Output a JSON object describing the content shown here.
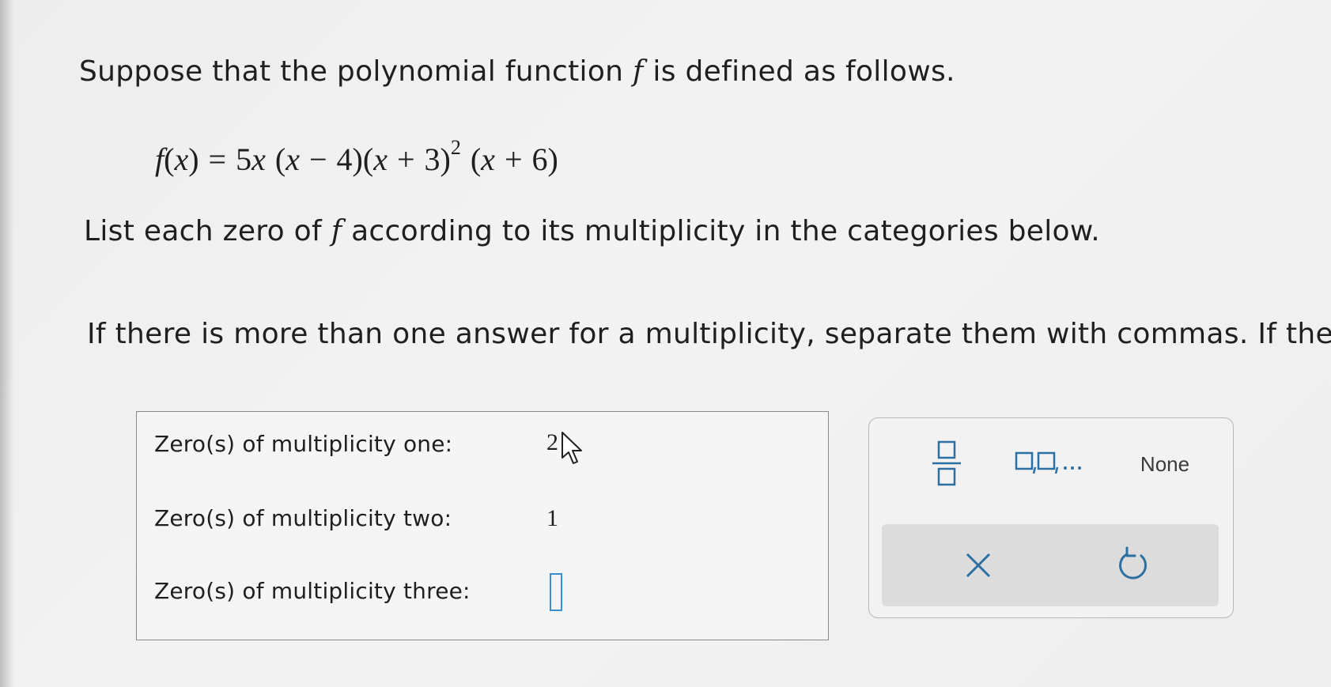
{
  "problem": {
    "intro_before": "Suppose that the polynomial function ",
    "function_name": "f",
    "intro_after": " is defined as follows.",
    "formula": {
      "lhs_fn": "f",
      "lhs_arg": "x",
      "eq": " = 5",
      "t1": "x",
      "p2_open": " (",
      "t2": "x",
      "p2_rest": " − 4)",
      "p3_open": "(",
      "t3": "x",
      "p3_rest": " + 3)",
      "p3_exp": "2",
      "p4_open": " (",
      "t4": "x",
      "p4_rest": " + 6)"
    },
    "list_before": "List each zero of ",
    "list_after": " according to its multiplicity in the categories below.",
    "hint": "If there is more than one answer for a multiplicity, separate them with commas. If there"
  },
  "answers": {
    "rows": [
      {
        "label": "Zero(s) of multiplicity one:",
        "value": "2"
      },
      {
        "label": "Zero(s) of multiplicity two:",
        "value": "1"
      },
      {
        "label": "Zero(s) of multiplicity three:",
        "value": ""
      }
    ]
  },
  "keypad": {
    "none_label": "None"
  },
  "colors": {
    "key_blue": "#2b6fa3",
    "cursor_blue": "#3a8fd0"
  }
}
